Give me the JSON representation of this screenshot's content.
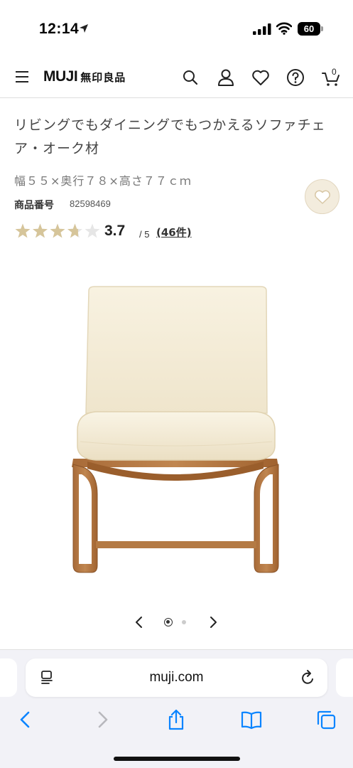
{
  "status_bar": {
    "time": "12:14",
    "battery": "60",
    "icons": [
      "location-arrow-icon",
      "signal-icon",
      "wifi-icon",
      "battery-icon"
    ]
  },
  "header": {
    "logo_en": "MUJI",
    "logo_jp": "無印良品",
    "cart_count": "0",
    "icons": [
      "hamburger-icon",
      "search-icon",
      "account-icon",
      "heart-icon",
      "help-icon",
      "cart-icon"
    ]
  },
  "product": {
    "title": "リビングでもダイニングでもつかえるソファチェア・オーク材",
    "size": "幅５５×奥行７８×高さ７７ｃｍ",
    "code_label": "商品番号",
    "code": "82598469",
    "rating": {
      "value": "3.7",
      "max": "/ 5",
      "stars": 3.7,
      "reviews": "(46件)"
    },
    "favorite_icon": "heart-icon"
  },
  "carousel": {
    "count": 2,
    "active": 1,
    "icons": [
      "chevron-left-icon",
      "chevron-right-icon"
    ]
  },
  "browser": {
    "url": "muji.com",
    "toolbar_icons": [
      "back-icon",
      "forward-icon",
      "share-icon",
      "bookmarks-icon",
      "tabs-icon"
    ]
  },
  "colors": {
    "star_fill": "#d6c59a",
    "star_empty": "#e6e6e6",
    "favorite_bg": "#f3ecdd",
    "ios_blue": "#0a84ff",
    "cushion": "#f5eedb",
    "wood": "#b57a45"
  }
}
